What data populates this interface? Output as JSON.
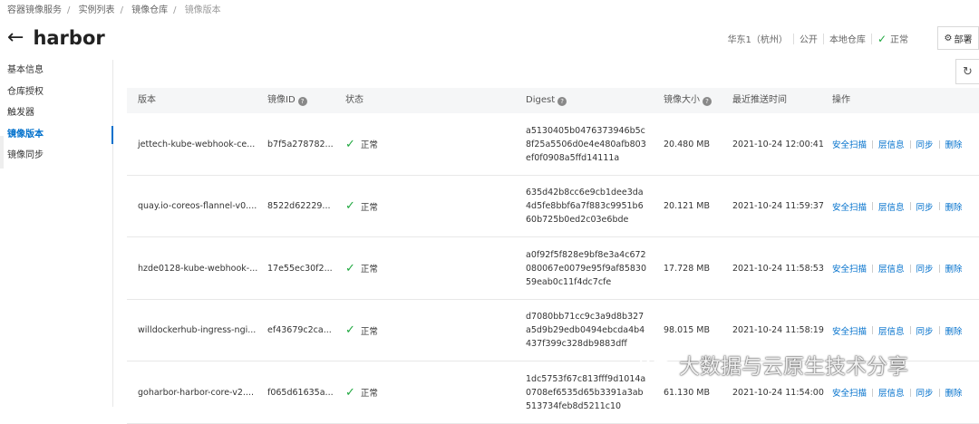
{
  "breadcrumb": [
    "容器镜像服务",
    "实例列表",
    "镜像仓库",
    "镜像版本"
  ],
  "title": "harbor",
  "status": {
    "region": "华东1（杭州）",
    "visibility": "公开",
    "source": "本地仓库",
    "state": "正常"
  },
  "deploy_button": "部署",
  "sidebar": [
    {
      "label": "基本信息",
      "active": false
    },
    {
      "label": "仓库授权",
      "active": false
    },
    {
      "label": "触发器",
      "active": false
    },
    {
      "label": "镜像版本",
      "active": true
    },
    {
      "label": "镜像同步",
      "active": false
    }
  ],
  "table": {
    "headers": {
      "version": "版本",
      "image_id": "镜像ID",
      "state": "状态",
      "digest": "Digest",
      "size": "镜像大小",
      "pushed": "最近推送时间",
      "ops": "操作"
    },
    "ops": [
      "安全扫描",
      "层信息",
      "同步",
      "删除"
    ],
    "rows": [
      {
        "version": "jettech-kube-webhook-ce...",
        "image_id": "b7f5a278782...",
        "state": "正常",
        "digest": "a5130405b0476373946b5c8f25a5506d0e4e480afb803ef0f0908a5ffd14111a",
        "size": "20.480 MB",
        "pushed": "2021-10-24 12:00:41"
      },
      {
        "version": "quay.io-coreos-flannel-v0....",
        "image_id": "8522d62229...",
        "state": "正常",
        "digest": "635d42b8cc6e9cb1dee3da4d5fe8bbf6a7f883c9951b660b725b0ed2c03e6bde",
        "size": "20.121 MB",
        "pushed": "2021-10-24 11:59:37"
      },
      {
        "version": "hzde0128-kube-webhook-...",
        "image_id": "17e55ec30f2...",
        "state": "正常",
        "digest": "a0f92f5f828e9bf8e3a4c672080067e0079e95f9af8583059eab0c11f4dc7cfe",
        "size": "17.728 MB",
        "pushed": "2021-10-24 11:58:53"
      },
      {
        "version": "willdockerhub-ingress-ngi...",
        "image_id": "ef43679c2ca...",
        "state": "正常",
        "digest": "d7080bb71cc9c3a9d8b327a5d9b29edb0494ebcda4b4437f399c328db9883dff",
        "size": "98.015 MB",
        "pushed": "2021-10-24 11:58:19"
      },
      {
        "version": "goharbor-harbor-core-v2....",
        "image_id": "f065d61635a...",
        "state": "正常",
        "digest": "1dc5753f67c813fff9d1014a0708ef6535d65b3391a3ab513734feb8d5211c10",
        "size": "61.130 MB",
        "pushed": "2021-10-24 11:54:00"
      }
    ]
  },
  "watermark": "大数据与云原生技术分享",
  "icons": {
    "back": "arrow-left-icon",
    "refresh": "refresh-icon",
    "help": "help-circle-icon",
    "check": "check-icon",
    "deploy": "gear-icon"
  },
  "colors": {
    "link": "#0070cc",
    "ok": "#1fa83f"
  }
}
